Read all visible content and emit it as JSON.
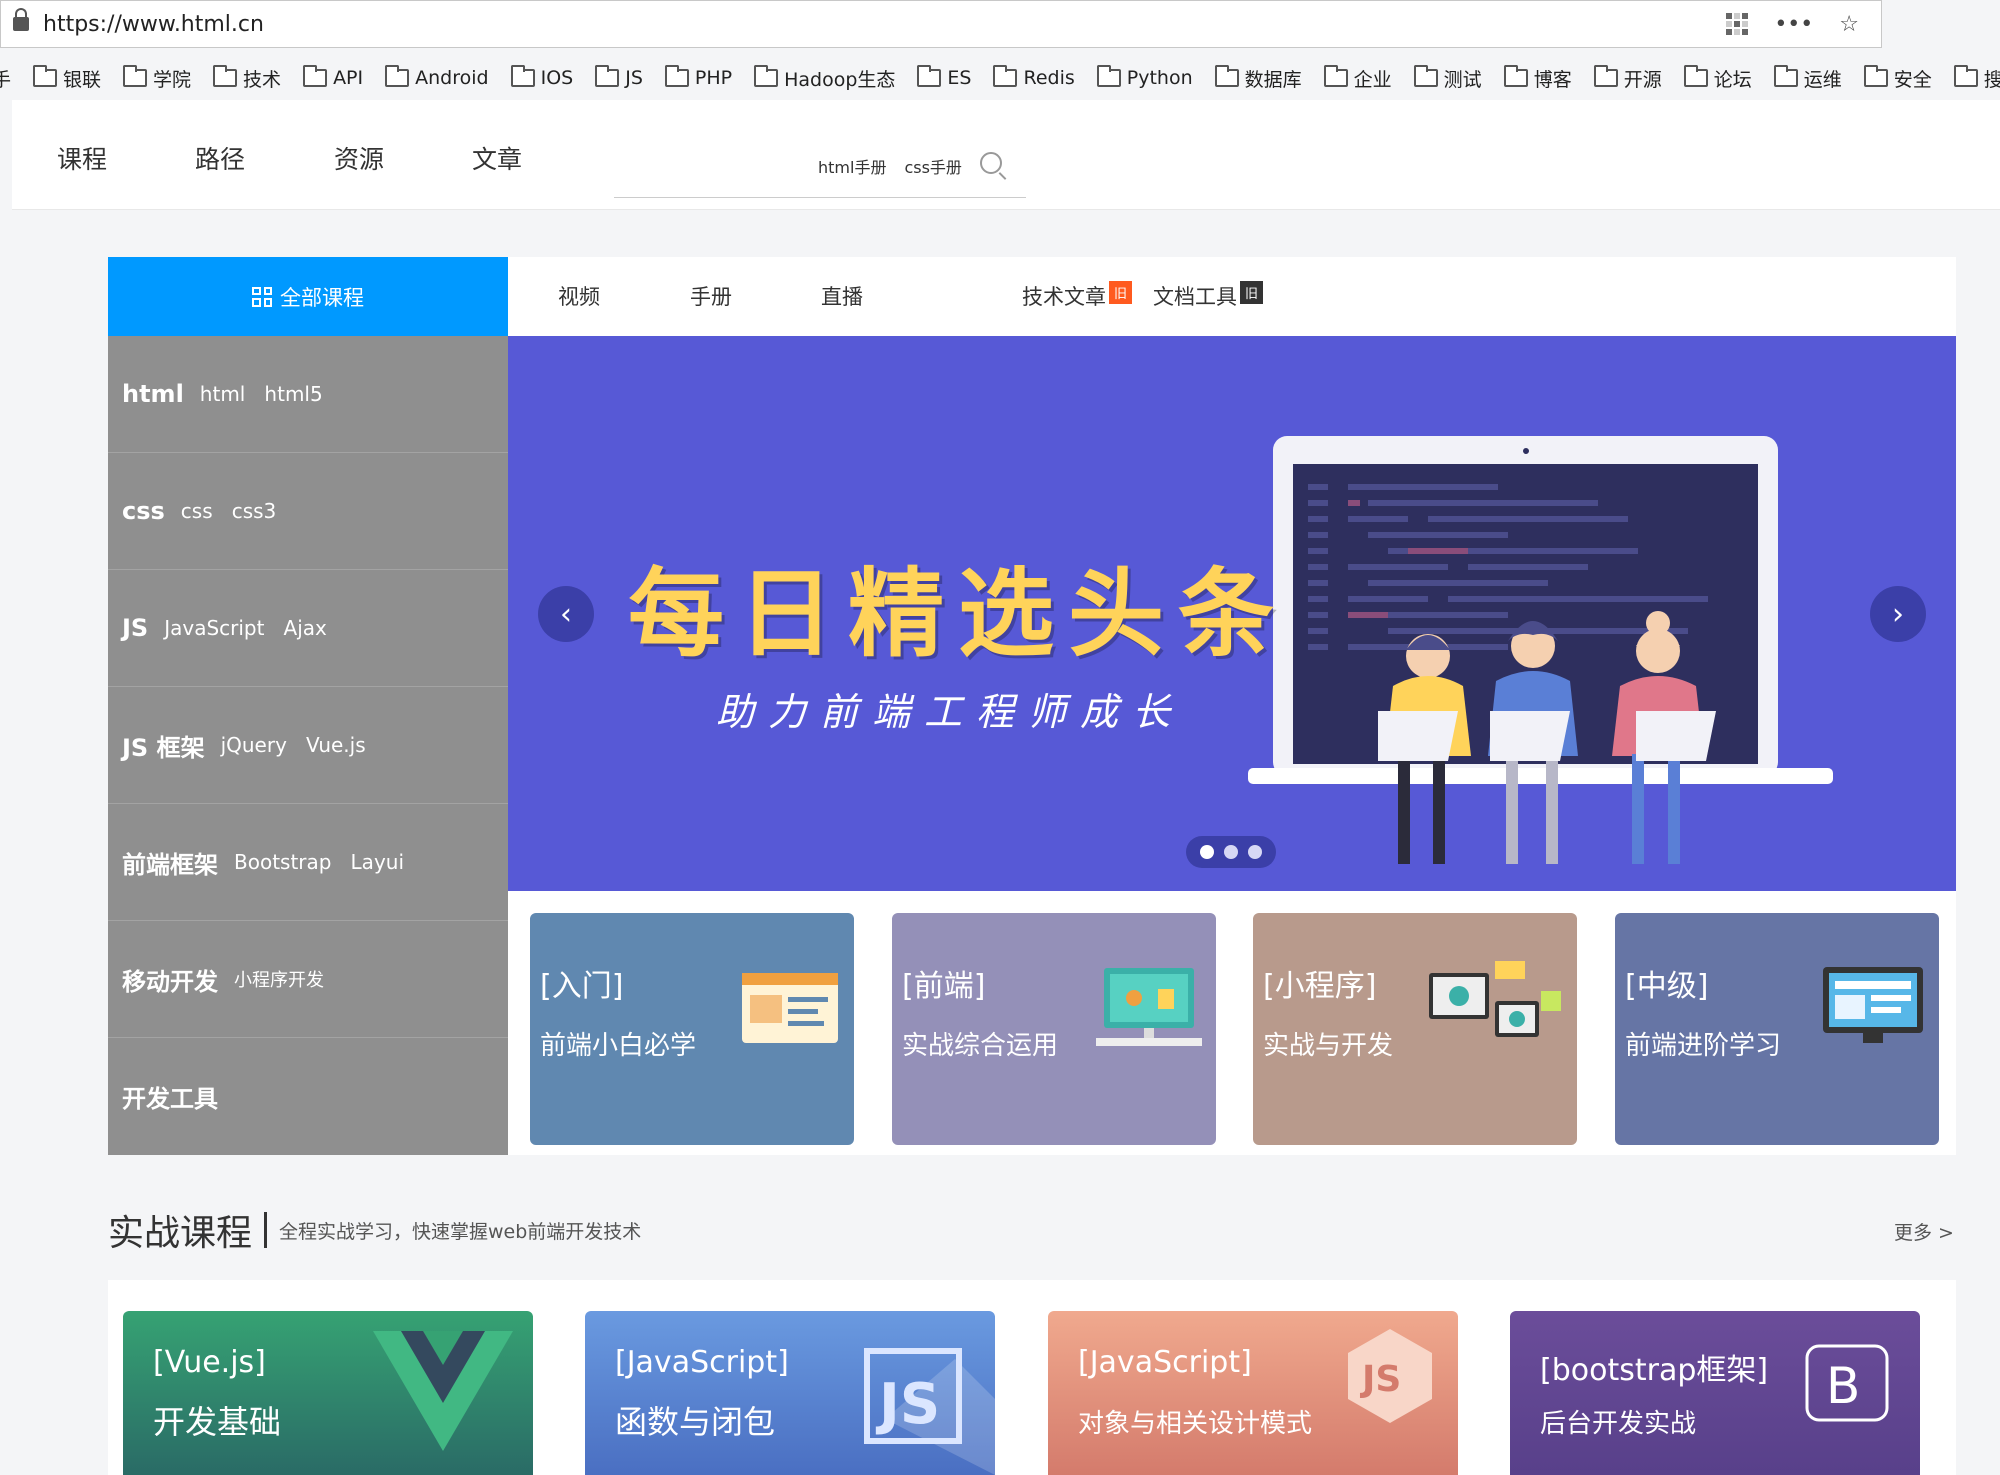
{
  "browser": {
    "url": "https://www.html.cn",
    "more_label": "•••",
    "star_label": "☆",
    "bookmarks": [
      "手",
      "银联",
      "学院",
      "技术",
      "API",
      "Android",
      "IOS",
      "JS",
      "PHP",
      "Hadoop生态",
      "ES",
      "Redis",
      "Python",
      "数据库",
      "企业",
      "测试",
      "博客",
      "开源",
      "论坛",
      "运维",
      "安全",
      "搜索"
    ]
  },
  "header": {
    "nav": [
      "课程",
      "路径",
      "资源",
      "文章"
    ],
    "search_hot": [
      "html手册",
      "css手册"
    ]
  },
  "main": {
    "all_courses_label": "全部课程",
    "tabs": [
      {
        "label": "视频"
      },
      {
        "label": "手册"
      },
      {
        "label": "直播"
      },
      {
        "label": "技术文章",
        "badge": "旧",
        "badge_color": "#ff5a1f"
      },
      {
        "label": "文档工具",
        "badge": "旧",
        "badge_color": "#333333"
      }
    ],
    "sidebar": [
      {
        "main": "html",
        "subs": "html   html5"
      },
      {
        "main": "css",
        "subs": "css   css3"
      },
      {
        "main": "JS",
        "subs": "JavaScript   Ajax"
      },
      {
        "main": "JS 框架",
        "subs": "jQuery   Vue.js"
      },
      {
        "main": "前端框架",
        "subs": "Bootstrap   Layui"
      },
      {
        "main": "移动开发",
        "subs": "小程序开发"
      },
      {
        "main": "开发工具",
        "subs": ""
      }
    ],
    "banner": {
      "title": "每日精选头条",
      "subtitle": "助力前端工程师成长",
      "prev": "‹",
      "next": "›"
    },
    "mini_cards": [
      {
        "tag": "[入门]",
        "desc": "前端小白必学",
        "color": "#6088b0"
      },
      {
        "tag": "[前端]",
        "desc": "实战综合运用",
        "color": "#9490b8"
      },
      {
        "tag": "[小程序]",
        "desc": "实战与开发",
        "color": "#b89a8c"
      },
      {
        "tag": "[中级]",
        "desc": "前端进阶学习",
        "color": "#6675a5"
      }
    ]
  },
  "section": {
    "title": "实战课程",
    "subtitle": "全程实战学习，快速掌握web前端开发技术",
    "more": "更多 >"
  },
  "courses": [
    {
      "tag": "[Vue.js]",
      "desc": "开发基础",
      "logo": "V",
      "color1": "#36a273",
      "color2": "#2a6b66"
    },
    {
      "tag": "[JavaScript]",
      "desc": "函数与闭包",
      "logo": "JS",
      "color1": "#6a9ae0",
      "color2": "#4a6fc2"
    },
    {
      "tag": "[JavaScript]",
      "desc": "对象与相关设计模式",
      "logo": "JS",
      "color1": "#f0a98e",
      "color2": "#d47b6c"
    },
    {
      "tag": "[bootstrap框架]",
      "desc": "后台开发实战",
      "logo": "B",
      "color1": "#6b4d9a",
      "color2": "#58408a"
    }
  ]
}
